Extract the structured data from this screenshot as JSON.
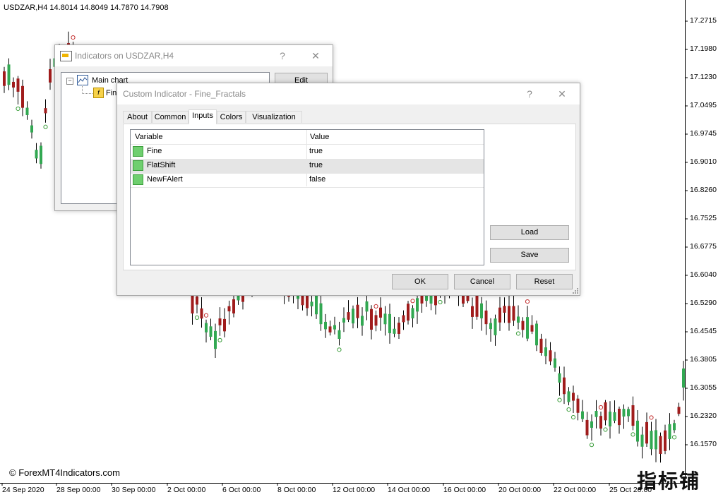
{
  "chart": {
    "title": "USDZAR,H4  14.8014 14.8049 14.7870 14.7908",
    "watermark": "© ForexMT4Indicators.com",
    "corner_logo": "指标铺",
    "price_labels": [
      "17.2715",
      "17.1980",
      "17.1230",
      "17.0495",
      "16.9745",
      "16.9010",
      "16.8260",
      "16.7525",
      "16.6775",
      "16.6040",
      "16.5290",
      "16.4545",
      "16.3805",
      "16.3055",
      "16.2320",
      "16.1570"
    ],
    "time_labels": [
      "24 Sep 2020",
      "28 Sep 00:00",
      "30 Sep 00:00",
      "2 Oct 00:00",
      "6 Oct 00:00",
      "8 Oct 00:00",
      "12 Oct 00:00",
      "14 Oct 00:00",
      "16 Oct 00:00",
      "20 Oct 00:00",
      "22 Oct 00:00",
      "25 Oct 20:00"
    ],
    "colors": {
      "bull": "#32a852",
      "bear": "#a01c1c",
      "fractal_up": "#c43232",
      "fractal_down": "#3c9e3c"
    }
  },
  "indicators_window": {
    "title": "Indicators on USDZAR,H4",
    "help_icon": "?",
    "close_icon": "✕",
    "tree": {
      "root_label": "Main chart",
      "child_label": "Fin"
    },
    "edit_label": "Edit"
  },
  "custom_indicator_window": {
    "title": "Custom Indicator - Fine_Fractals",
    "help_icon": "?",
    "close_icon": "✕",
    "tabs": [
      "About",
      "Common",
      "Inputs",
      "Colors",
      "Visualization"
    ],
    "active_tab": "Inputs",
    "grid": {
      "headers": [
        "Variable",
        "Value"
      ],
      "rows": [
        {
          "name": "Fine",
          "value": "true"
        },
        {
          "name": "FlatShift",
          "value": "true"
        },
        {
          "name": "NewFAlert",
          "value": "false"
        }
      ]
    },
    "load_label": "Load",
    "save_label": "Save",
    "ok_label": "OK",
    "cancel_label": "Cancel",
    "reset_label": "Reset"
  }
}
